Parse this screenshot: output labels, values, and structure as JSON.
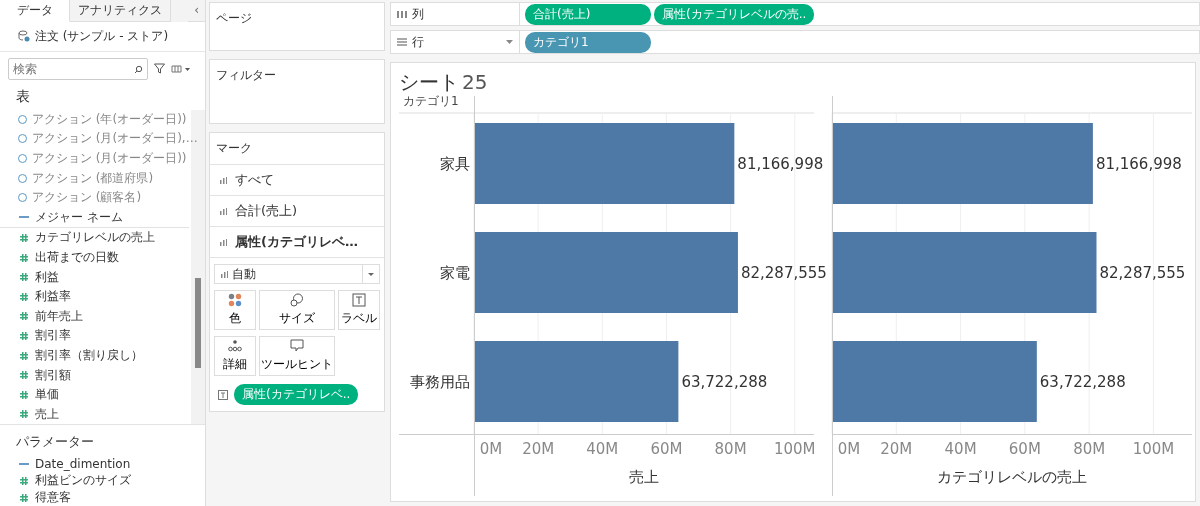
{
  "sidebar": {
    "tabs": [
      {
        "label": "データ",
        "selected": true
      },
      {
        "label": "アナリティクス",
        "selected": false
      }
    ],
    "collapse": "‹",
    "data_source": "注文 (サンプル - ストア)",
    "search": {
      "placeholder": "検索"
    },
    "section_title": "表",
    "fields": [
      {
        "kind": "action",
        "label": "アクション (年(オーダー日))"
      },
      {
        "kind": "action",
        "label": "アクション (月(オーダー日),…"
      },
      {
        "kind": "action",
        "label": "アクション (月(オーダー日))"
      },
      {
        "kind": "action",
        "label": "アクション (都道府県)"
      },
      {
        "kind": "action",
        "label": "アクション (顧客名)"
      },
      {
        "kind": "text",
        "label": "メジャー ネーム"
      },
      {
        "kind": "calc",
        "label": "カテゴリレベルの売上"
      },
      {
        "kind": "calc",
        "label": "出荷までの日数"
      },
      {
        "kind": "measure",
        "label": "利益"
      },
      {
        "kind": "calc",
        "label": "利益率"
      },
      {
        "kind": "calc",
        "label": "前年売上"
      },
      {
        "kind": "measure",
        "label": "割引率"
      },
      {
        "kind": "calc",
        "label": "割引率（割り戻し）"
      },
      {
        "kind": "calc",
        "label": "割引額"
      },
      {
        "kind": "calc",
        "label": "単価"
      },
      {
        "kind": "measure",
        "label": "売上"
      }
    ],
    "parameters_title": "パラメーター",
    "parameters": [
      {
        "kind": "text",
        "label": "Date_dimention"
      },
      {
        "kind": "measure",
        "label": "利益ビンのサイズ"
      },
      {
        "kind": "measure",
        "label": "得意客"
      }
    ]
  },
  "pages_card": {
    "title": "ページ"
  },
  "filters_card": {
    "title": "フィルター"
  },
  "marks_card": {
    "title": "マーク",
    "layers": [
      {
        "label": "すべて",
        "selected": false
      },
      {
        "label": "合計(売上)",
        "selected": false
      },
      {
        "label": "属性(カテゴリレベ…",
        "selected": true
      }
    ],
    "mark_type": "自動",
    "buttons": [
      {
        "kind": "color",
        "label": "色"
      },
      {
        "kind": "size",
        "label": "サイズ"
      },
      {
        "kind": "label",
        "label": "ラベル"
      },
      {
        "kind": "detail",
        "label": "詳細"
      },
      {
        "kind": "tooltip",
        "label": "ツールヒント"
      }
    ],
    "pills": [
      {
        "label": "属性(カテゴリレベ..",
        "color": "#00b180"
      }
    ]
  },
  "shelves": [
    {
      "kind": "columns",
      "label": "列",
      "pills": [
        {
          "label": "合計(売上)",
          "color": "#00b180"
        },
        {
          "label": "属性(カテゴリレベルの売..",
          "color": "#00b180"
        }
      ]
    },
    {
      "kind": "rows",
      "label": "行",
      "pills": [
        {
          "label": "カテゴリ1",
          "color": "#4996b2"
        }
      ]
    }
  ],
  "view": {
    "title": "シート",
    "number": "25",
    "row_header": "カテゴリ1",
    "charts": [
      {
        "chart_data": {
          "type": "bar",
          "orientation": "horizontal",
          "grid": true,
          "xlabel": "売上",
          "categories": [
            "家具",
            "家電",
            "事務用品"
          ],
          "series": [
            {
              "color": "#4e79a7",
              "values": [
                81166998,
                82287555,
                63722288
              ]
            }
          ],
          "value_labels": [
            "81,166,998",
            "82,287,555",
            "63,722,288"
          ],
          "xlim": [
            0,
            106000000
          ],
          "xticks": [
            {
              "value": 0,
              "label": "0M"
            },
            {
              "value": 20000000,
              "label": "20M"
            },
            {
              "value": 40000000,
              "label": "40M"
            },
            {
              "value": 60000000,
              "label": "60M"
            },
            {
              "value": 80000000,
              "label": "80M"
            },
            {
              "value": 100000000,
              "label": "100M"
            }
          ]
        }
      },
      {
        "chart_data": {
          "type": "bar",
          "orientation": "horizontal",
          "grid": true,
          "xlabel": "カテゴリレベルの売上",
          "series": [
            {
              "color": "#4e79a7",
              "values": [
                81166998,
                82287555,
                63722288
              ]
            }
          ],
          "value_labels": [
            "81,166,998",
            "82,287,555",
            "63,722,288"
          ],
          "xlim": [
            0,
            112000000
          ],
          "xticks": [
            {
              "value": 0,
              "label": "0M"
            },
            {
              "value": 20000000,
              "label": "20M"
            },
            {
              "value": 40000000,
              "label": "40M"
            },
            {
              "value": 60000000,
              "label": "60M"
            },
            {
              "value": 80000000,
              "label": "80M"
            },
            {
              "value": 100000000,
              "label": "100M"
            }
          ]
        }
      }
    ]
  }
}
